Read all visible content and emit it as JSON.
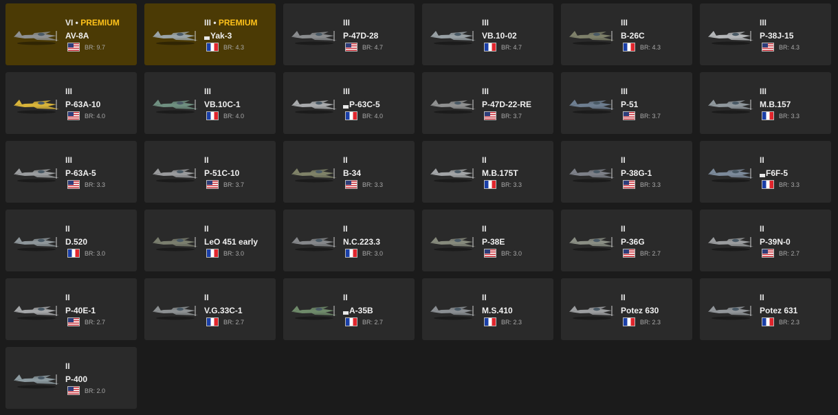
{
  "vehicles": [
    {
      "rank": "VI",
      "premium": true,
      "premium_label": "PREMIUM",
      "name": "AV-8A",
      "marked": false,
      "flag": "us",
      "br": "BR: 9.7",
      "color": "#8e9092"
    },
    {
      "rank": "III",
      "premium": true,
      "premium_label": "PREMIUM",
      "name": "Yak-3",
      "marked": true,
      "flag": "fr",
      "br": "BR: 4.3",
      "color": "#9aa4a8"
    },
    {
      "rank": "III",
      "premium": false,
      "name": "P-47D-28",
      "marked": false,
      "flag": "us",
      "br": "BR: 4.7",
      "color": "#8a8c8e"
    },
    {
      "rank": "III",
      "premium": false,
      "name": "VB.10-02",
      "marked": false,
      "flag": "fr",
      "br": "BR: 4.7",
      "color": "#98a0a4"
    },
    {
      "rank": "III",
      "premium": false,
      "name": "B-26C",
      "marked": false,
      "flag": "fr",
      "br": "BR: 4.3",
      "color": "#7e806a"
    },
    {
      "rank": "III",
      "premium": false,
      "name": "P-38J-15",
      "marked": false,
      "flag": "us",
      "br": "BR: 4.3",
      "color": "#b4b6b8"
    },
    {
      "rank": "III",
      "premium": false,
      "name": "P-63A-10",
      "marked": false,
      "flag": "us",
      "br": "BR: 4.0",
      "color": "#d8b43a"
    },
    {
      "rank": "III",
      "premium": false,
      "name": "VB.10C-1",
      "marked": false,
      "flag": "fr",
      "br": "BR: 4.0",
      "color": "#6f8f80"
    },
    {
      "rank": "III",
      "premium": false,
      "name": "P-63C-5",
      "marked": true,
      "flag": "fr",
      "br": "BR: 4.0",
      "color": "#a8aaac"
    },
    {
      "rank": "III",
      "premium": false,
      "name": "P-47D-22-RE",
      "marked": false,
      "flag": "us",
      "br": "BR: 3.7",
      "color": "#8f9090"
    },
    {
      "rank": "III",
      "premium": false,
      "name": "P-51",
      "marked": false,
      "flag": "us",
      "br": "BR: 3.7",
      "color": "#6e7e90"
    },
    {
      "rank": "III",
      "premium": false,
      "name": "M.B.157",
      "marked": false,
      "flag": "fr",
      "br": "BR: 3.3",
      "color": "#8f979c"
    },
    {
      "rank": "III",
      "premium": false,
      "name": "P-63A-5",
      "marked": false,
      "flag": "us",
      "br": "BR: 3.3",
      "color": "#9a9c9e"
    },
    {
      "rank": "II",
      "premium": false,
      "name": "P-51C-10",
      "marked": false,
      "flag": "us",
      "br": "BR: 3.7",
      "color": "#999a9c"
    },
    {
      "rank": "II",
      "premium": false,
      "name": "B-34",
      "marked": false,
      "flag": "us",
      "br": "BR: 3.3",
      "color": "#7f8268"
    },
    {
      "rank": "II",
      "premium": false,
      "name": "M.B.175T",
      "marked": false,
      "flag": "fr",
      "br": "BR: 3.3",
      "color": "#a2a4a6"
    },
    {
      "rank": "II",
      "premium": false,
      "name": "P-38G-1",
      "marked": false,
      "flag": "us",
      "br": "BR: 3.3",
      "color": "#7d8088"
    },
    {
      "rank": "II",
      "premium": false,
      "name": "F6F-5",
      "marked": true,
      "flag": "fr",
      "br": "BR: 3.3",
      "color": "#7c8a9a"
    },
    {
      "rank": "II",
      "premium": false,
      "name": "D.520",
      "marked": false,
      "flag": "fr",
      "br": "BR: 3.0",
      "color": "#8e969a"
    },
    {
      "rank": "II",
      "premium": false,
      "name": "LeO 451 early",
      "marked": false,
      "flag": "fr",
      "br": "BR: 3.0",
      "color": "#7a7e6e"
    },
    {
      "rank": "II",
      "premium": false,
      "name": "N.C.223.3",
      "marked": false,
      "flag": "fr",
      "br": "BR: 3.0",
      "color": "#85878a"
    },
    {
      "rank": "II",
      "premium": false,
      "name": "P-38E",
      "marked": false,
      "flag": "us",
      "br": "BR: 3.0",
      "color": "#868a7c"
    },
    {
      "rank": "II",
      "premium": false,
      "name": "P-36G",
      "marked": false,
      "flag": "us",
      "br": "BR: 2.7",
      "color": "#8a8e84"
    },
    {
      "rank": "II",
      "premium": false,
      "name": "P-39N-0",
      "marked": false,
      "flag": "us",
      "br": "BR: 2.7",
      "color": "#9a9c9e"
    },
    {
      "rank": "II",
      "premium": false,
      "name": "P-40E-1",
      "marked": false,
      "flag": "us",
      "br": "BR: 2.7",
      "color": "#a4a6a8"
    },
    {
      "rank": "II",
      "premium": false,
      "name": "V.G.33C-1",
      "marked": false,
      "flag": "fr",
      "br": "BR: 2.7",
      "color": "#8c9092"
    },
    {
      "rank": "II",
      "premium": false,
      "name": "A-35B",
      "marked": true,
      "flag": "fr",
      "br": "BR: 2.7",
      "color": "#6f8a6a"
    },
    {
      "rank": "II",
      "premium": false,
      "name": "M.S.410",
      "marked": false,
      "flag": "fr",
      "br": "BR: 2.3",
      "color": "#8a8e92"
    },
    {
      "rank": "II",
      "premium": false,
      "name": "Potez 630",
      "marked": false,
      "flag": "fr",
      "br": "BR: 2.3",
      "color": "#9c9ea0"
    },
    {
      "rank": "II",
      "premium": false,
      "name": "Potez 631",
      "marked": false,
      "flag": "fr",
      "br": "BR: 2.3",
      "color": "#92969a"
    },
    {
      "rank": "II",
      "premium": false,
      "name": "P-400",
      "marked": false,
      "flag": "us",
      "br": "BR: 2.0",
      "color": "#8c9aa0"
    }
  ],
  "premium_separator": " • ",
  "icons": {
    "plane": "plane-icon",
    "flag_us": "us-flag-icon",
    "flag_fr": "france-flag-icon"
  }
}
